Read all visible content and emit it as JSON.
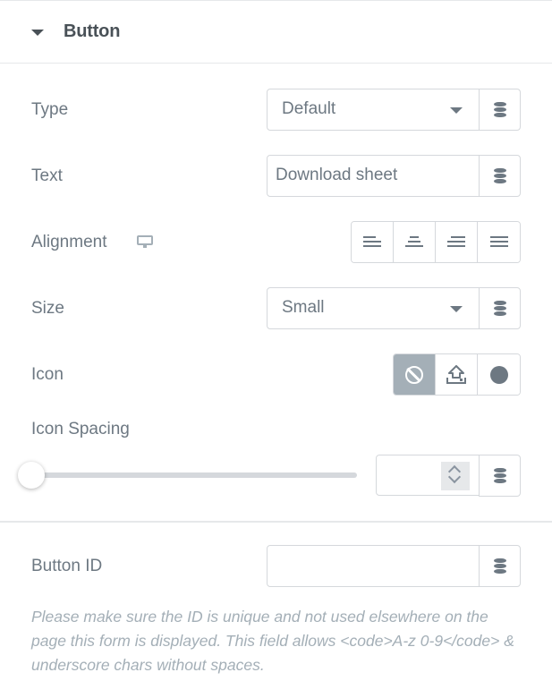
{
  "section": {
    "title": "Button",
    "expanded": true
  },
  "fields": {
    "type": {
      "label": "Type",
      "value": "Default"
    },
    "text": {
      "label": "Text",
      "value": "Download sheet"
    },
    "alignment": {
      "label": "Alignment",
      "device_icon": "desktop-icon",
      "options": [
        "align-left",
        "align-center",
        "align-right",
        "align-justify"
      ]
    },
    "size": {
      "label": "Size",
      "value": "Small"
    },
    "icon": {
      "label": "Icon",
      "options": [
        "none",
        "upload",
        "circle"
      ],
      "selected": "none"
    },
    "icon_spacing": {
      "label": "Icon Spacing",
      "value": "",
      "slider_fraction": 0
    },
    "button_id": {
      "label": "Button ID",
      "value": "",
      "help": "Please make sure the ID is unique and not used elsewhere on the page this form is displayed. This field allows <code>A-z 0-9</code> & underscore chars without spaces."
    }
  },
  "icons": {
    "dynamic": "database-icon",
    "collapse": "caret-down-icon"
  },
  "colors": {
    "text": "#6d7882",
    "border": "#d5d8dc",
    "active": "#a4afb7",
    "help": "#a4afb7"
  }
}
